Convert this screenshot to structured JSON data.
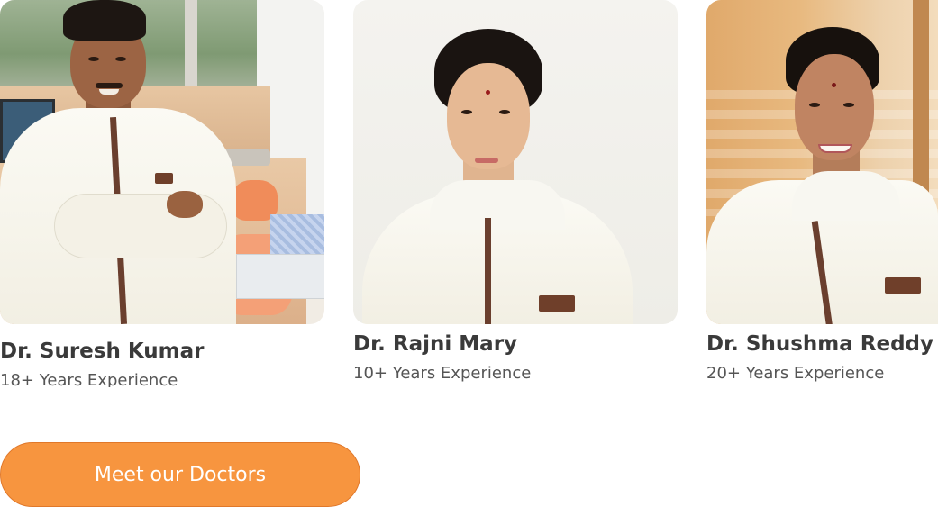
{
  "doctors": [
    {
      "name": "Dr. Suresh Kumar",
      "experience": "18+ Years Experience"
    },
    {
      "name": "Dr. Rajni Mary",
      "experience": "10+ Years Experience"
    },
    {
      "name": "Dr. Shushma Reddy",
      "experience": "20+ Years Experience"
    }
  ],
  "cta": {
    "label": "Meet our Doctors"
  },
  "colors": {
    "accent": "#f7953f",
    "name_text": "#3a3a3a",
    "body_text": "#555555"
  }
}
